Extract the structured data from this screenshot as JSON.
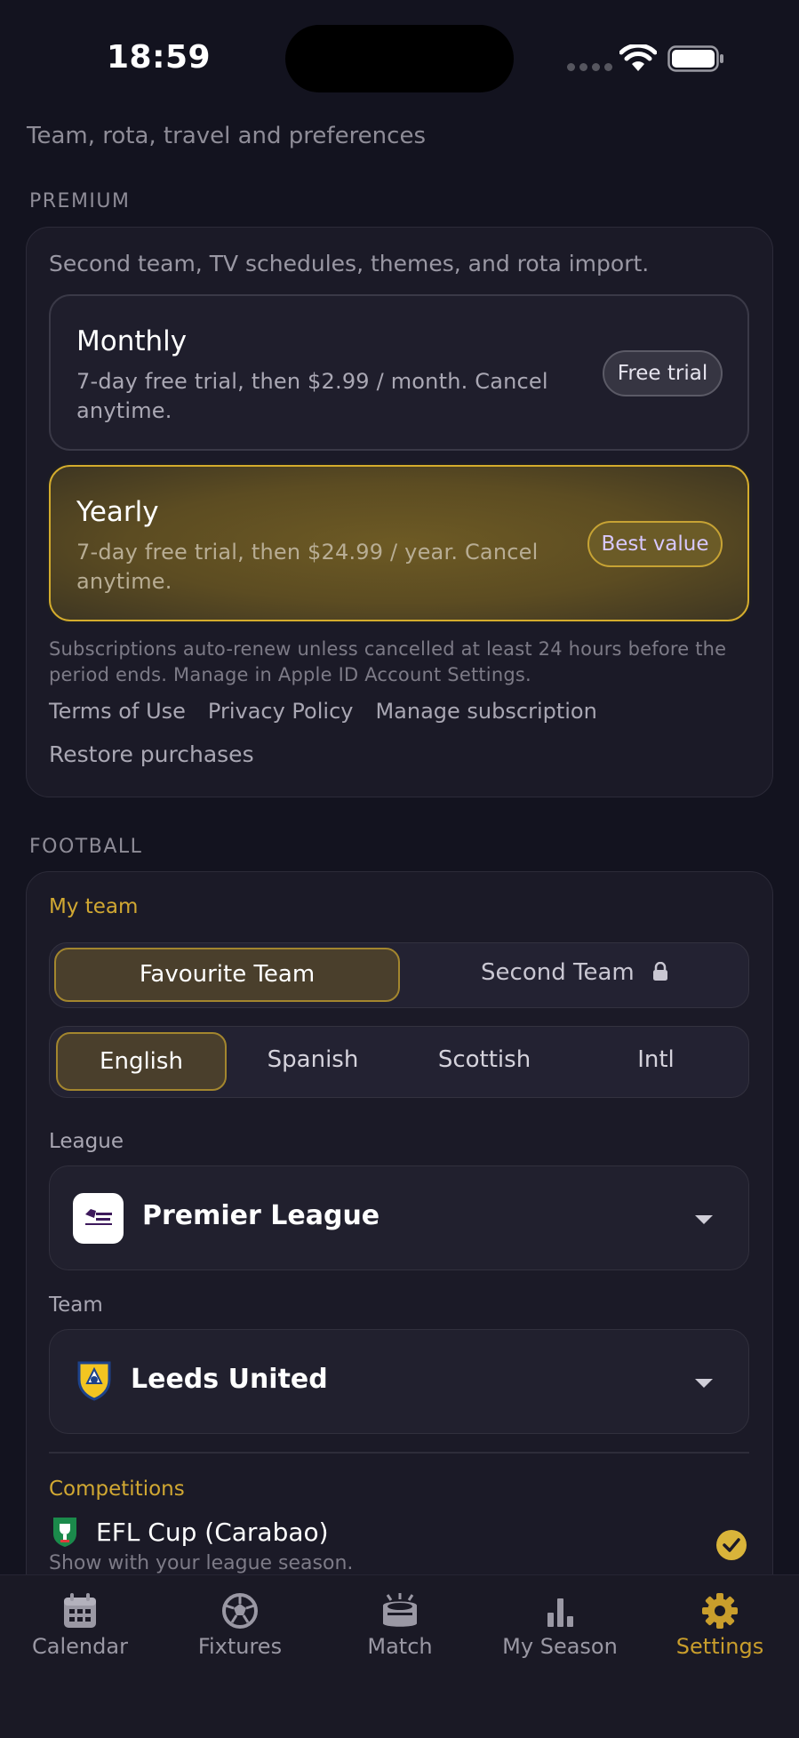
{
  "status": {
    "time": "18:59"
  },
  "subtitle": "Team, rota, travel and preferences",
  "premium": {
    "section": "PREMIUM",
    "description": "Second team, TV schedules, themes, and rota import.",
    "monthly": {
      "title": "Monthly",
      "desc": "7-day free trial, then $2.99 / month. Cancel anytime.",
      "badge": "Free trial"
    },
    "yearly": {
      "title": "Yearly",
      "desc": "7-day free trial, then $24.99 / year. Cancel anytime.",
      "badge": "Best value"
    },
    "fine_print": "Subscriptions auto-renew unless cancelled at least 24 hours before the period ends. Manage in Apple ID Account Settings.",
    "links": [
      "Terms of Use",
      "Privacy Policy",
      "Manage subscription"
    ],
    "restore": "Restore purchases"
  },
  "football": {
    "section": "FOOTBALL",
    "my_team": "My team",
    "team_tabs": [
      "Favourite Team",
      "Second Team"
    ],
    "regions": [
      "English",
      "Spanish",
      "Scottish",
      "Intl"
    ],
    "league_label": "League",
    "league_value": "Premier League",
    "team_label": "Team",
    "team_value": "Leeds United",
    "competitions_label": "Competitions",
    "competition": {
      "title": "EFL Cup (Carabao)",
      "subtitle": "Show with your league season.",
      "enabled": true
    }
  },
  "tabs": [
    {
      "label": "Calendar",
      "icon": "calendar-icon"
    },
    {
      "label": "Fixtures",
      "icon": "football-icon"
    },
    {
      "label": "Match",
      "icon": "stadium-icon"
    },
    {
      "label": "My Season",
      "icon": "bar-chart-icon"
    },
    {
      "label": "Settings",
      "icon": "gear-icon",
      "active": true
    }
  ],
  "colors": {
    "accent": "#d1a832",
    "background": "#13131f",
    "card": "#1b1a27"
  }
}
